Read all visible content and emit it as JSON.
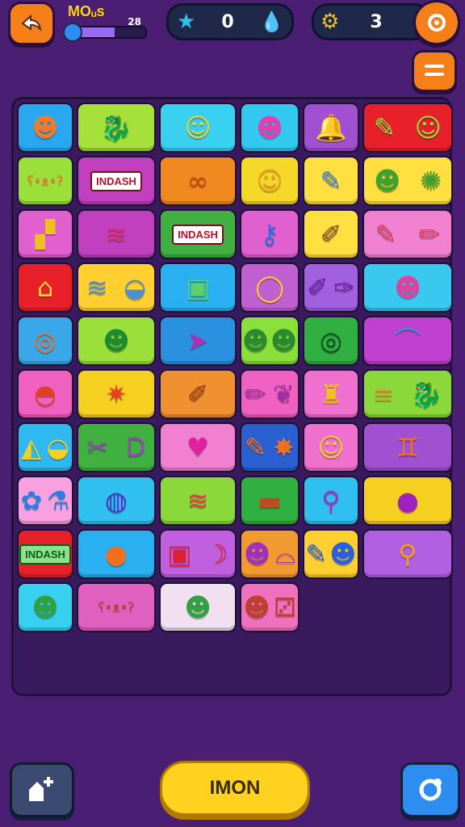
{
  "header": {
    "back_icon": "back-arrow-icon",
    "player_name": "MOᵤs",
    "level_label": "28",
    "level_progress": 0.6,
    "stars_value": "0",
    "coins_value": "3",
    "settings_icon": "gear-icon",
    "menu_icon": "hamburger-menu-icon"
  },
  "board": {
    "tiles": [
      {
        "name": "orange-ghost-tile",
        "glyphs": [
          "☻"
        ],
        "color": "#29a8f0",
        "glyph_color": "#f07a2a"
      },
      {
        "name": "green-dragon-tile",
        "glyphs": [
          "🐉"
        ],
        "color": "#a6e03a",
        "glyph_color": "#1e8a3a"
      },
      {
        "name": "yellow-dog-tile",
        "glyphs": [
          "☺"
        ],
        "color": "#3ad0f0",
        "glyph_color": "#f5d020"
      },
      {
        "name": "pink-monster-tile",
        "glyphs": [
          "☻"
        ],
        "color": "#33c8f0",
        "glyph_color": "#e040b0"
      },
      {
        "name": "bell-tile",
        "glyphs": [
          "🔔"
        ],
        "color": "#a050d0",
        "glyph_color": "#ffd23a"
      },
      {
        "name": "pencil-smiley-tile",
        "glyphs": [
          "✎",
          "☺"
        ],
        "color": "#e8202a",
        "glyph_color": "#90e040"
      },
      {
        "name": "bear-tile",
        "glyphs": [
          "ʕ•ᴥ•ʔ"
        ],
        "color": "#9be03a",
        "glyph_color": "#f07a2a"
      },
      {
        "name": "indash-label-tile",
        "tag": "INDASH",
        "color": "#c040c0"
      },
      {
        "name": "pretzel-tile",
        "glyphs": [
          "∞"
        ],
        "color": "#f08a20",
        "glyph_color": "#c84a10"
      },
      {
        "name": "yellow-blob-tile",
        "glyphs": [
          "☺"
        ],
        "color": "#f5d828",
        "glyph_color": "#f0a020"
      },
      {
        "name": "pencil-tile",
        "glyphs": [
          "✎"
        ],
        "color": "#ffe040",
        "glyph_color": "#3a7ad0"
      },
      {
        "name": "bug-cookie-tile",
        "glyphs": [
          "☻",
          "✺"
        ],
        "color": "#ffe040",
        "glyph_color": "#40a030"
      },
      {
        "name": "blocks-tile",
        "glyphs": [
          "▞"
        ],
        "color": "#e060d0",
        "glyph_color": "#f0c020"
      },
      {
        "name": "striped-snake-tile",
        "glyphs": [
          "≋"
        ],
        "color": "#c040c0",
        "glyph_color": "#e03070"
      },
      {
        "name": "indash-candy-tile",
        "tag": "INDASH",
        "color": "#40b040"
      },
      {
        "name": "blue-key-tile",
        "glyphs": [
          "⚷"
        ],
        "color": "#e060d0",
        "glyph_color": "#2a70e0"
      },
      {
        "name": "brush-tile",
        "glyphs": [
          "✐"
        ],
        "color": "#ffe040",
        "glyph_color": "#8a4a20"
      },
      {
        "name": "pen-pencil-tile",
        "glyphs": [
          "✎",
          "✏"
        ],
        "color": "#f080d0",
        "glyph_color": "#e04060"
      },
      {
        "name": "house-tile",
        "glyphs": [
          "⌂"
        ],
        "color": "#e8202a",
        "glyph_color": "#ffd23a"
      },
      {
        "name": "wrap-sushi-tile",
        "glyphs": [
          "≋",
          "◒"
        ],
        "color": "#ffd030",
        "glyph_color": "#5090d0"
      },
      {
        "name": "gift-box-tile",
        "glyphs": [
          "▣"
        ],
        "color": "#2ab0f0",
        "glyph_color": "#60d060"
      },
      {
        "name": "ring-tile",
        "glyphs": [
          "◯"
        ],
        "color": "#c060d0",
        "glyph_color": "#ffd020"
      },
      {
        "name": "purple-brush-tile",
        "glyphs": [
          "✐",
          "✑"
        ],
        "color": "#a060e0",
        "glyph_color": "#7020a0"
      },
      {
        "name": "pink-cat-tile",
        "glyphs": [
          "☻"
        ],
        "color": "#38c8f0",
        "glyph_color": "#e040a0"
      },
      {
        "name": "donut-tile",
        "glyphs": [
          "◎"
        ],
        "color": "#3aa8e8",
        "glyph_color": "#f07020"
      },
      {
        "name": "turtle-tile",
        "glyphs": [
          "☻"
        ],
        "color": "#9be03a",
        "glyph_color": "#208a30"
      },
      {
        "name": "paper-plane-tile",
        "glyphs": [
          "➤"
        ],
        "color": "#2a90e0",
        "glyph_color": "#b030b0"
      },
      {
        "name": "bug-pair-tile",
        "glyphs": [
          "☻",
          "☻"
        ],
        "color": "#8ae03a",
        "glyph_color": "#2a8a30"
      },
      {
        "name": "green-loop-tile",
        "glyphs": [
          "◎"
        ],
        "color": "#30b040",
        "glyph_color": "#104a20"
      },
      {
        "name": "mushroom-tile",
        "glyphs": [
          "⌒"
        ],
        "color": "#c040d0",
        "glyph_color": "#3a90e0"
      },
      {
        "name": "ufo-tile",
        "glyphs": [
          "◓"
        ],
        "color": "#f060c0",
        "glyph_color": "#e04020"
      },
      {
        "name": "burst-tile",
        "glyphs": [
          "✷"
        ],
        "color": "#f5d020",
        "glyph_color": "#e84020"
      },
      {
        "name": "carrot-brush-tile",
        "glyphs": [
          "✐"
        ],
        "color": "#f09030",
        "glyph_color": "#a04010"
      },
      {
        "name": "pencil-leaf-tile",
        "glyphs": [
          "✏",
          "❦"
        ],
        "color": "#f060c0",
        "glyph_color": "#a030a0"
      },
      {
        "name": "crown-tile",
        "glyphs": [
          "♜"
        ],
        "color": "#f070d0",
        "glyph_color": "#f0c020"
      },
      {
        "name": "chips-dragon-tile",
        "glyphs": [
          "≡",
          "🐉"
        ],
        "color": "#8ad83a",
        "glyph_color": "#e0a030"
      },
      {
        "name": "envelope-c-tile",
        "glyphs": [
          "◭",
          "◒"
        ],
        "color": "#30b8f0",
        "glyph_color": "#f5d020"
      },
      {
        "name": "tools-d-tile",
        "glyphs": [
          "✂",
          "D"
        ],
        "color": "#40b040",
        "glyph_color": "#a040c0"
      },
      {
        "name": "heart-tile",
        "glyphs": [
          "♥"
        ],
        "color": "#f080d0",
        "glyph_color": "#e020a0"
      },
      {
        "name": "rocket-star-tile",
        "glyphs": [
          "✎",
          "✸"
        ],
        "color": "#2a60d0",
        "glyph_color": "#f07020"
      },
      {
        "name": "lemon-tile",
        "glyphs": [
          "☺"
        ],
        "color": "#f070d0",
        "glyph_color": "#f5d020"
      },
      {
        "name": "swirl-tile",
        "glyphs": [
          "♊"
        ],
        "color": "#a050d0",
        "glyph_color": "#f07020"
      },
      {
        "name": "flower-potion-tile",
        "glyphs": [
          "✿",
          "⚗"
        ],
        "color": "#f8a0e0",
        "glyph_color": "#2a80e0"
      },
      {
        "name": "chat-ring-tile",
        "glyphs": [
          "◍"
        ],
        "color": "#30c0f0",
        "glyph_color": "#5030c0"
      },
      {
        "name": "rainbow-roll-tile",
        "glyphs": [
          "≋"
        ],
        "color": "#8ad83a",
        "glyph_color": "#e04040"
      },
      {
        "name": "wallet-tile",
        "glyphs": [
          "▬"
        ],
        "color": "#30b040",
        "glyph_color": "#c04a20"
      },
      {
        "name": "magnifier-tile",
        "glyphs": [
          "⚲"
        ],
        "color": "#30c0f0",
        "glyph_color": "#a030c0"
      },
      {
        "name": "plum-tile",
        "glyphs": [
          "●"
        ],
        "color": "#f5d020",
        "glyph_color": "#a020c0"
      },
      {
        "name": "indash-green-tile",
        "tag": "INDASH",
        "color": "#e8202a",
        "tag_green": true
      },
      {
        "name": "orange-fruit-tile",
        "glyphs": [
          "●"
        ],
        "color": "#2ab0f0",
        "glyph_color": "#f07020"
      },
      {
        "name": "red-box-banana-tile",
        "glyphs": [
          "▣",
          "☽"
        ],
        "color": "#c060e0",
        "glyph_color": "#e02030"
      },
      {
        "name": "purple-dog-sandwich-tile",
        "glyphs": [
          "☻",
          "⌓"
        ],
        "color": "#f09a30",
        "glyph_color": "#a030c0"
      },
      {
        "name": "blue-pen-monster-tile",
        "glyphs": [
          "✎",
          "☻"
        ],
        "color": "#ffd030",
        "glyph_color": "#2a60e0"
      },
      {
        "name": "maraca-tile",
        "glyphs": [
          "⚲"
        ],
        "color": "#b060e0",
        "glyph_color": "#f0a020"
      },
      {
        "name": "green-whale-tile",
        "glyphs": [
          "☻"
        ],
        "color": "#38d0f0",
        "glyph_color": "#30a040"
      },
      {
        "name": "pink-bear-tile",
        "glyphs": [
          "ʕ•ᴥ•ʔ"
        ],
        "color": "#e060c0",
        "glyph_color": "#c04030"
      },
      {
        "name": "turtle-bottom-tile",
        "glyphs": [
          "☻"
        ],
        "color": "#f0e0f0",
        "glyph_color": "#30a040"
      },
      {
        "name": "octopus-dice-tile",
        "glyphs": [
          "☻",
          "⚂"
        ],
        "color": "#f070c0",
        "glyph_color": "#c04030"
      }
    ]
  },
  "footer": {
    "left_icon": "add-piece-icon",
    "action_label": "IMON",
    "right_icon": "refresh-icon"
  },
  "colors": {
    "background": "#4a1f73",
    "accent_orange": "#f5801a",
    "action_yellow": "#ffd21f",
    "right_blue": "#2d8df0"
  }
}
